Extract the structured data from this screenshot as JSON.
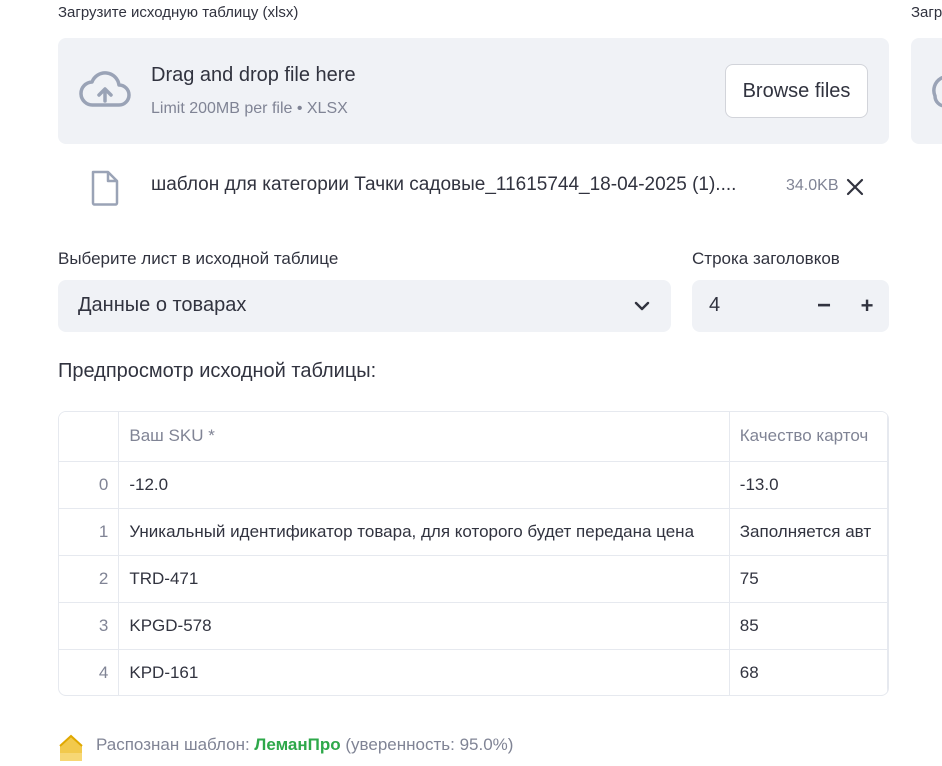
{
  "upload": {
    "label": "Загрузите исходную таблицу (xlsx)",
    "label_right": "Загр",
    "dropzone_title": "Drag and drop file here",
    "dropzone_limit": "Limit 200MB per file • XLSX",
    "browse_label": "Browse files",
    "icon": "cloud-upload-icon"
  },
  "file": {
    "icon": "file-icon",
    "name": "шаблон для категории Тачки садовые_11615744_18-04-2025 (1)....",
    "size": "34.0KB",
    "close_icon": "close-icon"
  },
  "sheet_select": {
    "label": "Выберите лист в исходной таблице",
    "value": "Данные о товарах"
  },
  "header_row": {
    "label": "Строка заголовков",
    "value": "4",
    "minus": "−",
    "plus": "+"
  },
  "preview": {
    "title": "Предпросмотр исходной таблицы:",
    "columns": [
      "",
      "Ваш SKU *",
      "Качество карточ"
    ],
    "rows": [
      [
        "0",
        "-12.0",
        "-13.0"
      ],
      [
        "1",
        "Уникальный идентификатор товара, для которого будет передана цена",
        "Заполняется авт"
      ],
      [
        "2",
        "TRD-471",
        "75"
      ],
      [
        "3",
        "KPGD-578",
        "85"
      ],
      [
        "4",
        "KPD-161",
        "68"
      ]
    ]
  },
  "recognized": {
    "prefix": "Распознан шаблон: ",
    "name": "ЛеманПро",
    "suffix": " (уверенность: 95.0%)",
    "icon": "house-icon",
    "accent_color": "#2ea84a"
  },
  "colors": {
    "surface": "#f0f2f6",
    "text": "#31333f",
    "muted": "#808495",
    "border": "#e6e9ef"
  }
}
